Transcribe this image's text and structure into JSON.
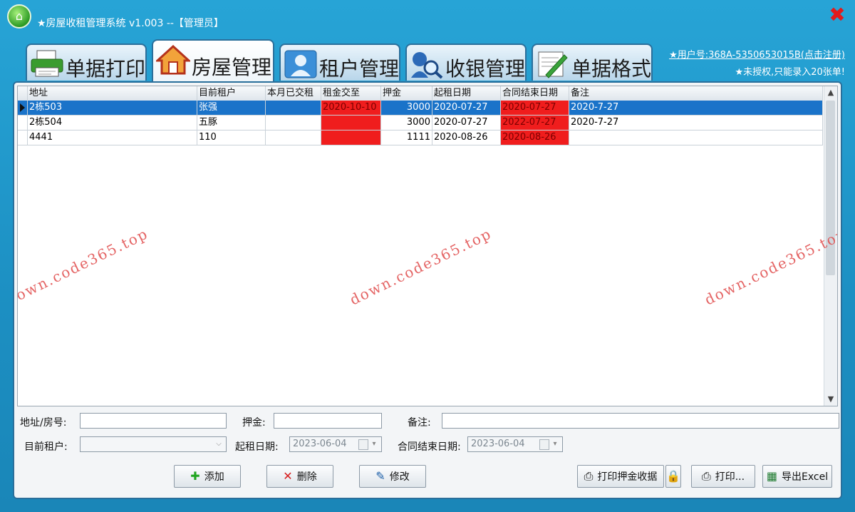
{
  "window": {
    "title": "★房屋收租管理系统 v1.003  --【管理员】",
    "close_glyph": "✖"
  },
  "account": {
    "user_no": "★用户号:368A-5350653015B(点击注册)",
    "license": "★未授权,只能录入20张单!"
  },
  "tabs": [
    {
      "label": "单据打印",
      "icon": "printer-icon"
    },
    {
      "label": "房屋管理",
      "icon": "house-icon",
      "active": true
    },
    {
      "label": "租户管理",
      "icon": "person-icon"
    },
    {
      "label": "收银管理",
      "icon": "magnifier-icon"
    },
    {
      "label": "单据格式",
      "icon": "pencil-icon"
    }
  ],
  "grid": {
    "columns": [
      "地址",
      "目前租户",
      "本月已交租",
      "租金交至",
      "押金",
      "起租日期",
      "合同结束日期",
      "备注"
    ],
    "rows": [
      {
        "address": "2栋503",
        "tenant": "张强",
        "paid": "",
        "rent_until": "2020-10-10",
        "deposit": "3000",
        "start": "2020-07-27",
        "end": "2020-07-27",
        "note": "2020-7-27",
        "selected": true
      },
      {
        "address": "2栋504",
        "tenant": "五豚",
        "paid": "",
        "rent_until": "",
        "deposit": "3000",
        "start": "2020-07-27",
        "end": "2022-07-27",
        "note": "2020-7-27"
      },
      {
        "address": "4441",
        "tenant": "110",
        "paid": "",
        "rent_until": "",
        "deposit": "1111",
        "start": "2020-08-26",
        "end": "2020-08-26",
        "note": ""
      }
    ],
    "highlight_color": "#f01d1d",
    "selected_color": "#1a73c9"
  },
  "watermark": "down.code365.top",
  "form": {
    "address_label": "地址/房号:",
    "address_value": "",
    "deposit_label": "押金:",
    "deposit_value": "",
    "note_label": "备注:",
    "note_value": "",
    "tenant_label": "目前租户:",
    "tenant_value": "",
    "start_label": "起租日期:",
    "start_value": "2023-06-04",
    "end_label": "合同结束日期:",
    "end_value": "2023-06-04"
  },
  "buttons": {
    "add": "添加",
    "delete": "删除",
    "edit": "修改",
    "print_deposit": "打印押金收据",
    "print": "打印...",
    "export": "导出Excel"
  }
}
